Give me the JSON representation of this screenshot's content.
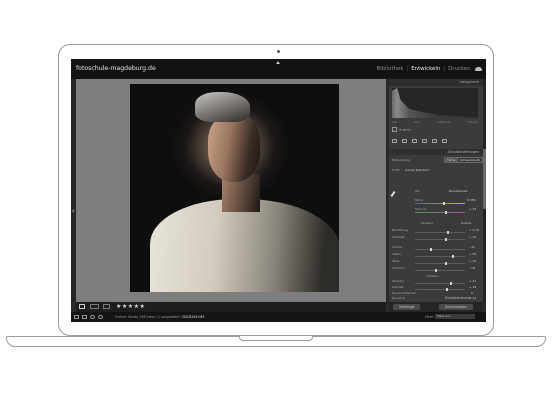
{
  "app": {
    "site_title": "fotoschule-magdeburg.de",
    "modules": [
      "Bibliothek",
      "Entwickeln",
      "Drucken"
    ],
    "active_module": "Entwickeln",
    "separator": "|"
  },
  "panel": {
    "histogram_title": "Histogramm",
    "hist_info": [
      "ISO",
      "f/3.5",
      "1/160 Sek",
      "50 mm"
    ],
    "original_label": "Original",
    "basic_title": "Grundeinstellungen",
    "treatment_label": "Behandlung",
    "treatment_options": [
      "Farbe",
      "Schwarzweiß"
    ],
    "profile_label": "Profil",
    "profile_value": "Adobe Standard",
    "wb_label": "WA",
    "wb_value": "Benutzerdef.",
    "temp_label": "Temp",
    "temp_value": "5.350",
    "tint_label": "Tönung",
    "tint_value": "+ 15",
    "tone_label": "Tonwert",
    "auto_label": "Autom.",
    "rows": [
      {
        "label": "Belichtung",
        "value": "+ 0,70"
      },
      {
        "label": "Kontrast",
        "value": "+ 24"
      },
      {
        "label": "Lichter",
        "value": "- 41"
      },
      {
        "label": "Tiefen",
        "value": "+ 50"
      },
      {
        "label": "Weiß",
        "value": "+ 20"
      },
      {
        "label": "Schwarz",
        "value": "- 18"
      }
    ],
    "presence_label": "Präsenz",
    "presence_rows": [
      {
        "label": "Struktur",
        "value": "+ 41"
      },
      {
        "label": "Klarheit",
        "value": "+ 26"
      },
      {
        "label": "Dunst entfernen",
        "value": "0"
      },
      {
        "label": "Dynamik",
        "value": "+ 14"
      },
      {
        "label": "Sättigung",
        "value": "- 20"
      }
    ],
    "tone_curve_title": "Gradationskurve",
    "prev_button": "Vorherige",
    "reset_button": "Zurücksetzen"
  },
  "toolbar": {
    "stars": "★★★★★"
  },
  "filmstrip": {
    "source": "Ordner: Studio",
    "count": "198 Fotos / 1 ausgewählt /",
    "filename": "DSC8294.NEF",
    "filter_label": "Filter:",
    "filter_value": "Filter aus"
  },
  "colors": {
    "topbar_bg": "#121212",
    "canvas_bg": "#7e7e7e",
    "panel_bg": "#3b3b3b"
  }
}
